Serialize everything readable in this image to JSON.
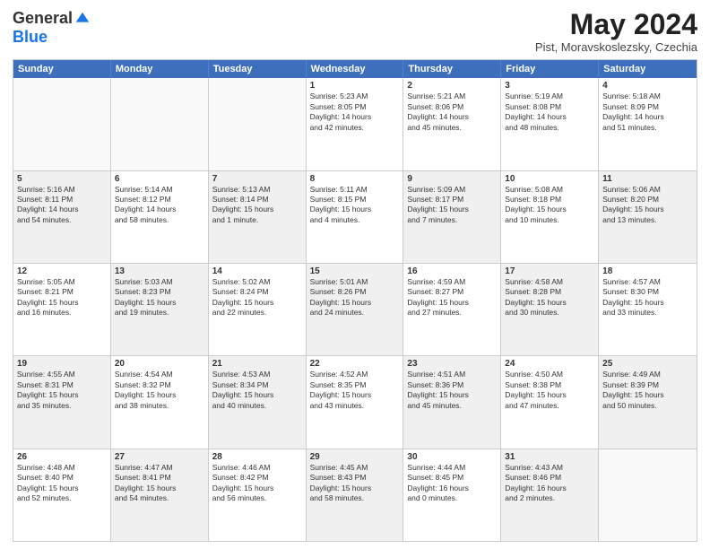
{
  "logo": {
    "general": "General",
    "blue": "Blue"
  },
  "title": "May 2024",
  "subtitle": "Pist, Moravskoslezsky, Czechia",
  "weekdays": [
    "Sunday",
    "Monday",
    "Tuesday",
    "Wednesday",
    "Thursday",
    "Friday",
    "Saturday"
  ],
  "rows": [
    [
      {
        "day": "",
        "text": "",
        "empty": true
      },
      {
        "day": "",
        "text": "",
        "empty": true
      },
      {
        "day": "",
        "text": "",
        "empty": true
      },
      {
        "day": "1",
        "text": "Sunrise: 5:23 AM\nSunset: 8:05 PM\nDaylight: 14 hours\nand 42 minutes."
      },
      {
        "day": "2",
        "text": "Sunrise: 5:21 AM\nSunset: 8:06 PM\nDaylight: 14 hours\nand 45 minutes."
      },
      {
        "day": "3",
        "text": "Sunrise: 5:19 AM\nSunset: 8:08 PM\nDaylight: 14 hours\nand 48 minutes."
      },
      {
        "day": "4",
        "text": "Sunrise: 5:18 AM\nSunset: 8:09 PM\nDaylight: 14 hours\nand 51 minutes."
      }
    ],
    [
      {
        "day": "5",
        "text": "Sunrise: 5:16 AM\nSunset: 8:11 PM\nDaylight: 14 hours\nand 54 minutes.",
        "shaded": true
      },
      {
        "day": "6",
        "text": "Sunrise: 5:14 AM\nSunset: 8:12 PM\nDaylight: 14 hours\nand 58 minutes."
      },
      {
        "day": "7",
        "text": "Sunrise: 5:13 AM\nSunset: 8:14 PM\nDaylight: 15 hours\nand 1 minute.",
        "shaded": true
      },
      {
        "day": "8",
        "text": "Sunrise: 5:11 AM\nSunset: 8:15 PM\nDaylight: 15 hours\nand 4 minutes."
      },
      {
        "day": "9",
        "text": "Sunrise: 5:09 AM\nSunset: 8:17 PM\nDaylight: 15 hours\nand 7 minutes.",
        "shaded": true
      },
      {
        "day": "10",
        "text": "Sunrise: 5:08 AM\nSunset: 8:18 PM\nDaylight: 15 hours\nand 10 minutes."
      },
      {
        "day": "11",
        "text": "Sunrise: 5:06 AM\nSunset: 8:20 PM\nDaylight: 15 hours\nand 13 minutes.",
        "shaded": true
      }
    ],
    [
      {
        "day": "12",
        "text": "Sunrise: 5:05 AM\nSunset: 8:21 PM\nDaylight: 15 hours\nand 16 minutes."
      },
      {
        "day": "13",
        "text": "Sunrise: 5:03 AM\nSunset: 8:23 PM\nDaylight: 15 hours\nand 19 minutes.",
        "shaded": true
      },
      {
        "day": "14",
        "text": "Sunrise: 5:02 AM\nSunset: 8:24 PM\nDaylight: 15 hours\nand 22 minutes."
      },
      {
        "day": "15",
        "text": "Sunrise: 5:01 AM\nSunset: 8:26 PM\nDaylight: 15 hours\nand 24 minutes.",
        "shaded": true
      },
      {
        "day": "16",
        "text": "Sunrise: 4:59 AM\nSunset: 8:27 PM\nDaylight: 15 hours\nand 27 minutes."
      },
      {
        "day": "17",
        "text": "Sunrise: 4:58 AM\nSunset: 8:28 PM\nDaylight: 15 hours\nand 30 minutes.",
        "shaded": true
      },
      {
        "day": "18",
        "text": "Sunrise: 4:57 AM\nSunset: 8:30 PM\nDaylight: 15 hours\nand 33 minutes."
      }
    ],
    [
      {
        "day": "19",
        "text": "Sunrise: 4:55 AM\nSunset: 8:31 PM\nDaylight: 15 hours\nand 35 minutes.",
        "shaded": true
      },
      {
        "day": "20",
        "text": "Sunrise: 4:54 AM\nSunset: 8:32 PM\nDaylight: 15 hours\nand 38 minutes."
      },
      {
        "day": "21",
        "text": "Sunrise: 4:53 AM\nSunset: 8:34 PM\nDaylight: 15 hours\nand 40 minutes.",
        "shaded": true
      },
      {
        "day": "22",
        "text": "Sunrise: 4:52 AM\nSunset: 8:35 PM\nDaylight: 15 hours\nand 43 minutes."
      },
      {
        "day": "23",
        "text": "Sunrise: 4:51 AM\nSunset: 8:36 PM\nDaylight: 15 hours\nand 45 minutes.",
        "shaded": true
      },
      {
        "day": "24",
        "text": "Sunrise: 4:50 AM\nSunset: 8:38 PM\nDaylight: 15 hours\nand 47 minutes."
      },
      {
        "day": "25",
        "text": "Sunrise: 4:49 AM\nSunset: 8:39 PM\nDaylight: 15 hours\nand 50 minutes.",
        "shaded": true
      }
    ],
    [
      {
        "day": "26",
        "text": "Sunrise: 4:48 AM\nSunset: 8:40 PM\nDaylight: 15 hours\nand 52 minutes."
      },
      {
        "day": "27",
        "text": "Sunrise: 4:47 AM\nSunset: 8:41 PM\nDaylight: 15 hours\nand 54 minutes.",
        "shaded": true
      },
      {
        "day": "28",
        "text": "Sunrise: 4:46 AM\nSunset: 8:42 PM\nDaylight: 15 hours\nand 56 minutes."
      },
      {
        "day": "29",
        "text": "Sunrise: 4:45 AM\nSunset: 8:43 PM\nDaylight: 15 hours\nand 58 minutes.",
        "shaded": true
      },
      {
        "day": "30",
        "text": "Sunrise: 4:44 AM\nSunset: 8:45 PM\nDaylight: 16 hours\nand 0 minutes."
      },
      {
        "day": "31",
        "text": "Sunrise: 4:43 AM\nSunset: 8:46 PM\nDaylight: 16 hours\nand 2 minutes.",
        "shaded": true
      },
      {
        "day": "",
        "text": "",
        "empty": true
      }
    ]
  ]
}
